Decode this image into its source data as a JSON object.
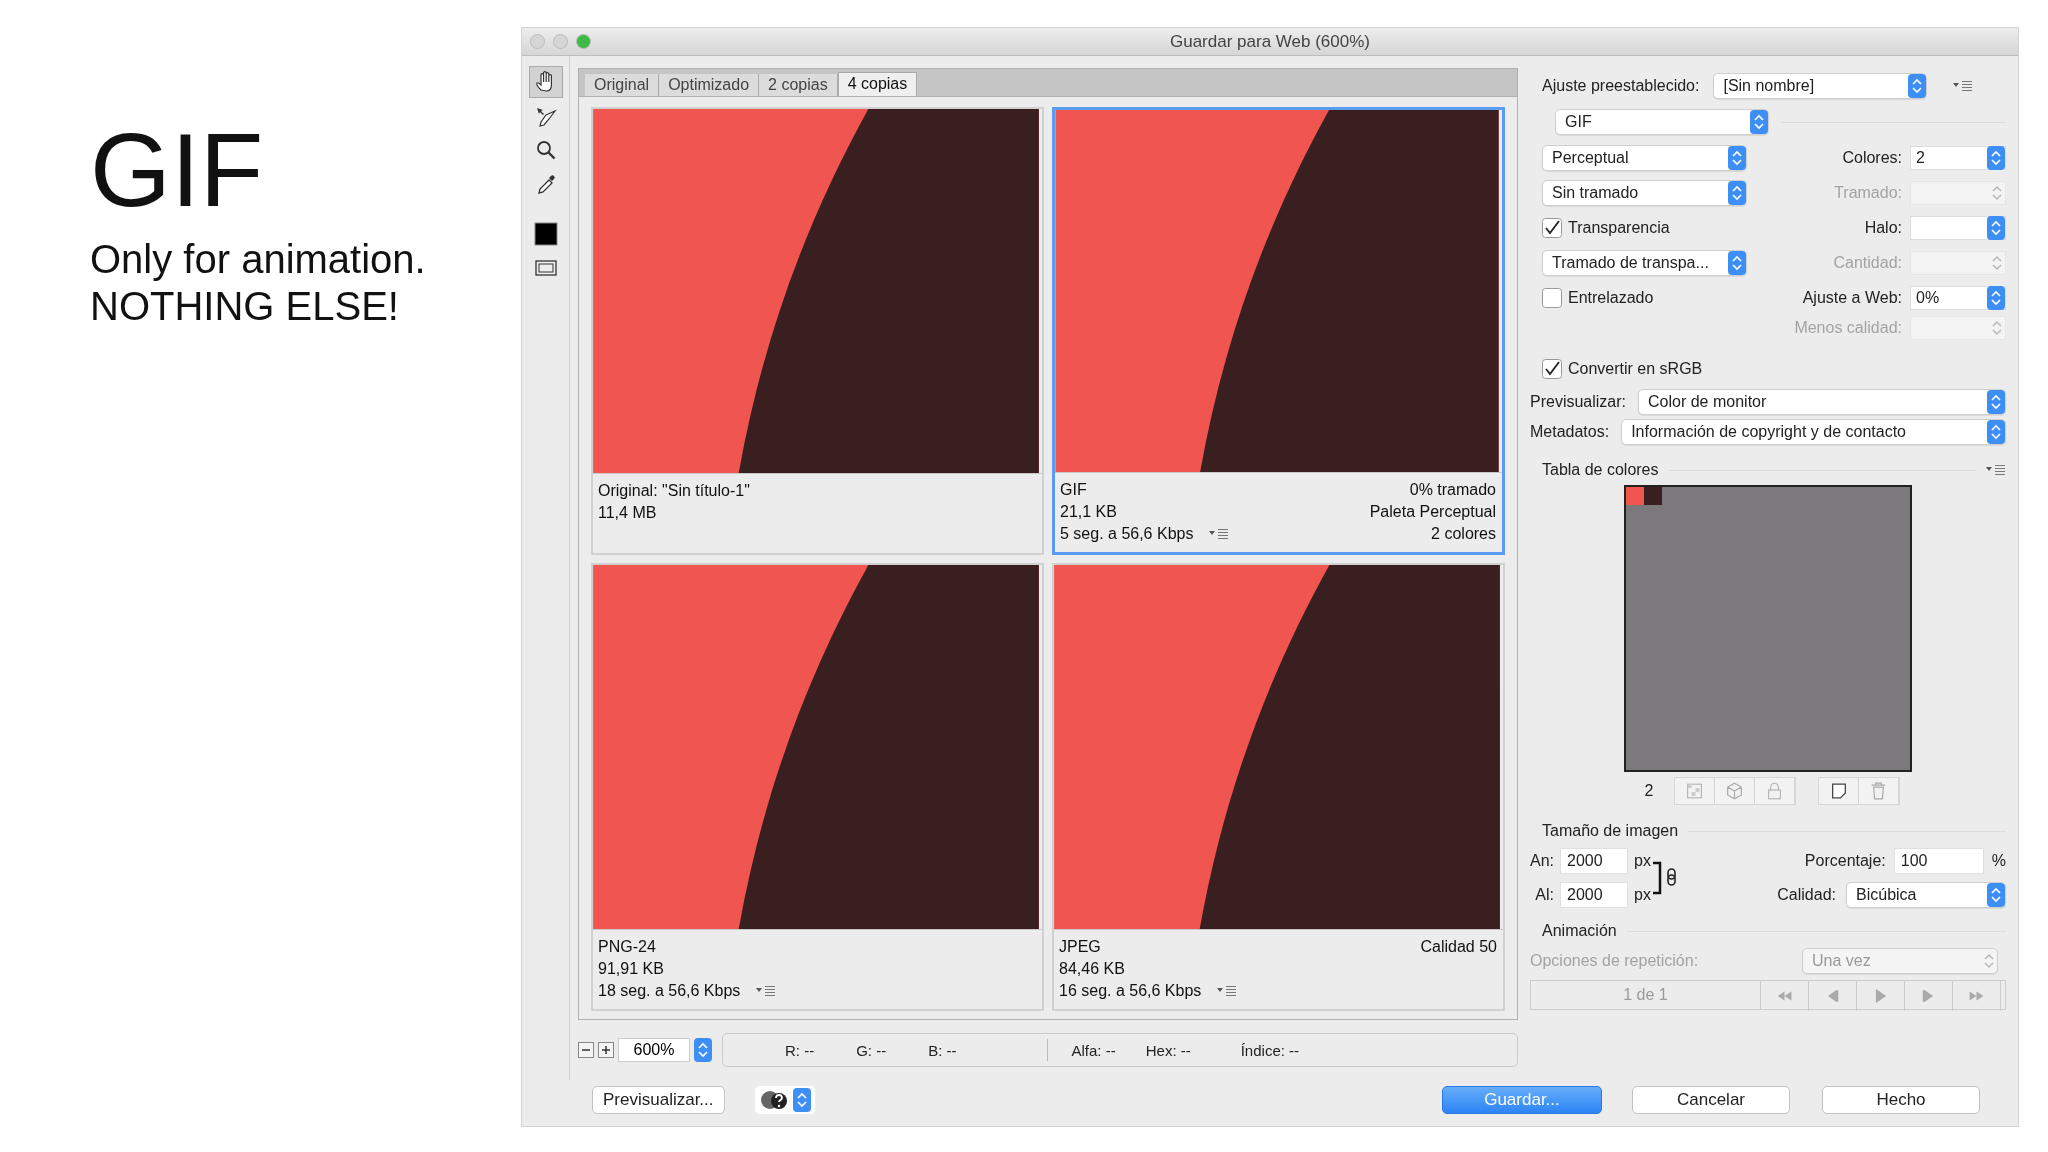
{
  "slide": {
    "title": "GIF",
    "lines": [
      "Only for animation.",
      "NOTHING ELSE!"
    ]
  },
  "window": {
    "title": "Guardar para Web (600%)"
  },
  "tools": [
    {
      "kind": "hand",
      "selected": true
    },
    {
      "kind": "slice",
      "selected": false
    },
    {
      "kind": "zoom",
      "selected": false
    },
    {
      "kind": "eyedropper",
      "selected": false
    },
    {
      "kind": "swatch",
      "selected": false
    },
    {
      "kind": "slices",
      "selected": false
    }
  ],
  "tabs": [
    {
      "label": "Original",
      "selected": false
    },
    {
      "label": "Optimizado",
      "selected": false
    },
    {
      "label": "2 copias",
      "selected": false
    },
    {
      "label": "4 copias",
      "selected": true
    }
  ],
  "panes": [
    {
      "selected": false,
      "menu": false,
      "left": [
        "Original: \"Sin título-1\"",
        "11,4 MB"
      ]
    },
    {
      "selected": true,
      "menu": true,
      "left": [
        "GIF",
        "21,1 KB",
        "5 seg. a 56,6 Kbps"
      ],
      "right": [
        "0% tramado",
        "Paleta Perceptual",
        "2 colores"
      ]
    },
    {
      "selected": false,
      "menu": true,
      "left": [
        "PNG-24",
        "91,91 KB",
        "18 seg. a 56,6 Kbps"
      ]
    },
    {
      "selected": false,
      "menu": true,
      "left": [
        "JPEG",
        "84,46 KB",
        "16 seg. a 56,6 Kbps"
      ],
      "right": [
        "Calidad 50"
      ]
    }
  ],
  "zoom": {
    "value": "600%"
  },
  "readouts": [
    "R: --",
    "G: --",
    "B: --",
    "Alfa: --",
    "Hex: --",
    "Índice: --"
  ],
  "buttons": [
    {
      "label": "Previsualizar...",
      "kind": "plain"
    },
    {
      "kind": "browser"
    },
    {
      "label": "Guardar...",
      "kind": "primary"
    },
    {
      "label": "Cancelar",
      "kind": "plain"
    },
    {
      "label": "Hecho",
      "kind": "plain"
    }
  ],
  "panel": {
    "preset": {
      "label": "Ajuste preestablecido:",
      "value": "[Sin nombre]"
    },
    "format": "GIF",
    "rows": [
      {
        "left": {
          "kind": "select",
          "value": "Perceptual"
        },
        "right": {
          "label": "Colores:",
          "value": "2",
          "disabled": false
        }
      },
      {
        "left": {
          "kind": "select",
          "value": "Sin tramado"
        },
        "right": {
          "label": "Tramado:",
          "disabled": true
        }
      },
      {
        "left": {
          "kind": "checkbox",
          "label": "Transparencia",
          "checked": true
        },
        "right": {
          "label": "Halo:",
          "disabled": false
        }
      },
      {
        "left": {
          "kind": "select",
          "value": "Tramado de transpa..."
        },
        "right": {
          "label": "Cantidad:",
          "disabled": true
        }
      },
      {
        "left": {
          "kind": "checkbox",
          "label": "Entrelazado",
          "checked": false
        },
        "right": {
          "label": "Ajuste a Web:",
          "value": "0%",
          "disabled": false
        }
      },
      {
        "right": {
          "label": "Menos calidad:",
          "disabled": true
        }
      }
    ],
    "srgb": {
      "label": "Convertir en sRGB",
      "checked": true
    },
    "preview": {
      "label": "Previsualizar:",
      "value": "Color de monitor"
    },
    "metadata": {
      "label": "Metadatos:",
      "value": "Información de copyright y de contacto"
    },
    "color_table": {
      "title": "Tabla de colores",
      "swatches": [
        {
          "color": "#f0554f"
        },
        {
          "color": "#3a1f21"
        }
      ],
      "count": "2"
    },
    "image_size": {
      "title": "Tamaño de imagen",
      "width": {
        "label": "An:",
        "value": "2000",
        "unit": "px"
      },
      "height": {
        "label": "Al:",
        "value": "2000",
        "unit": "px"
      },
      "percent": {
        "label": "Porcentaje:",
        "value": "100",
        "unit": "%"
      },
      "quality": {
        "label": "Calidad:",
        "value": "Bicúbica"
      }
    },
    "animation": {
      "title": "Animación",
      "loop": {
        "label": "Opciones de repetición:",
        "value": "Una vez"
      },
      "frame": "1 de 1"
    }
  }
}
